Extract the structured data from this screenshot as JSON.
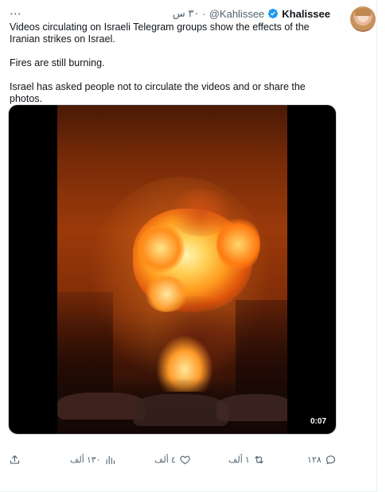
{
  "tweet": {
    "author": {
      "display_name": "Khalissee",
      "handle": "@Kahlissee",
      "verified": true
    },
    "time": "٣٠ س",
    "separator": "·",
    "more_icon": "⋯",
    "text": {
      "paragraph1": "Videos circulating on Israeli Telegram groups show the effects of the Iranian strikes on Israel.",
      "paragraph2": "Fires are still burning.",
      "paragraph3": "Israel has asked people not to circulate the videos and or share the photos."
    },
    "media": {
      "type": "video",
      "duration": "0:07"
    },
    "actions": {
      "replies": "١٢٨",
      "reposts": "١ ألف",
      "likes": "٤ ألف",
      "views": "١٣٠ ألف"
    }
  },
  "icons": {
    "verified": "verified-badge-icon",
    "reply": "reply-icon",
    "repost": "repost-icon",
    "like": "heart-icon",
    "views": "views-bar-icon",
    "share": "share-icon"
  },
  "colors": {
    "accent": "#1d9bf0",
    "text_primary": "#0f1419",
    "text_secondary": "#536471",
    "border": "#cfd9de"
  }
}
